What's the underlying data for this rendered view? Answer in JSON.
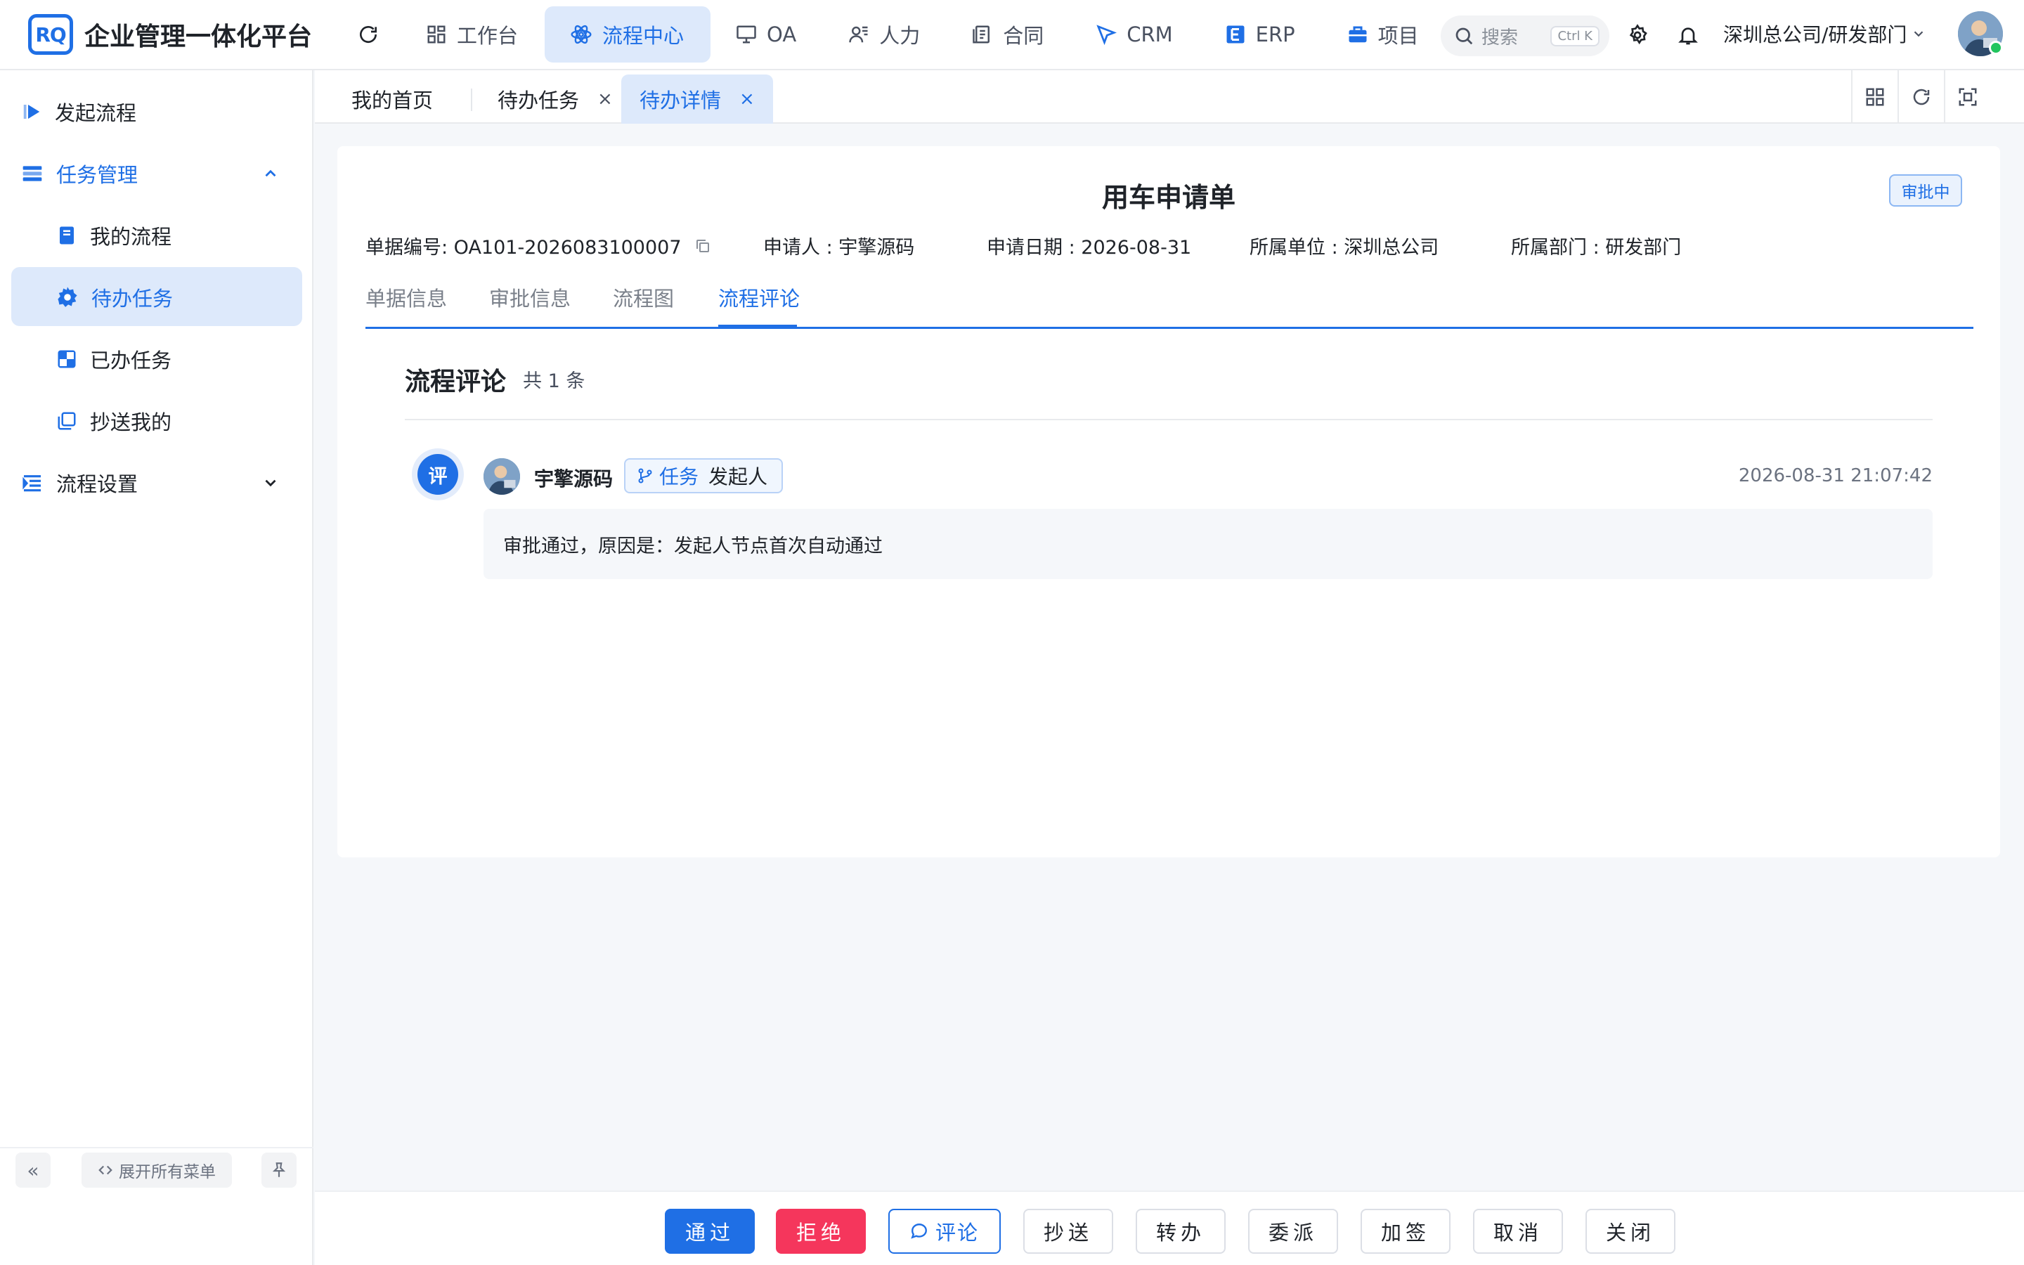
{
  "app": {
    "logo_text": "RQ",
    "title": "企业管理一体化平台"
  },
  "topnav": {
    "items": [
      {
        "label": "工作台",
        "icon": "dashboard-icon"
      },
      {
        "label": "流程中心",
        "icon": "workflow-icon"
      },
      {
        "label": "OA",
        "icon": "monitor-icon"
      },
      {
        "label": "人力",
        "icon": "people-icon"
      },
      {
        "label": "合同",
        "icon": "document-icon"
      },
      {
        "label": "CRM",
        "icon": "send-icon"
      },
      {
        "label": "ERP",
        "icon": "erp-icon"
      },
      {
        "label": "项目",
        "icon": "briefcase-icon"
      }
    ],
    "active_index": 1,
    "more": "···"
  },
  "header": {
    "search_placeholder": "搜索",
    "search_shortcut": "Ctrl K",
    "org": "深圳总公司/研发部门"
  },
  "sidebar": {
    "items": [
      {
        "label": "发起流程",
        "icon": "play-icon"
      },
      {
        "label": "任务管理",
        "icon": "task-list-icon"
      },
      {
        "label": "我的流程",
        "icon": "book-icon"
      },
      {
        "label": "待办任务",
        "icon": "gear-icon"
      },
      {
        "label": "已办任务",
        "icon": "checker-icon"
      },
      {
        "label": "抄送我的",
        "icon": "copy-icon"
      },
      {
        "label": "流程设置",
        "icon": "settings-list-icon"
      }
    ],
    "expand_all": "展开所有菜单",
    "collapse": "«"
  },
  "page_tabs": [
    {
      "label": "我的首页",
      "closable": false
    },
    {
      "label": "待办任务",
      "closable": true
    },
    {
      "label": "待办详情",
      "closable": true
    }
  ],
  "page_tabs_close": "×",
  "form": {
    "title": "用车申请单",
    "status": "审批中",
    "doc_no": "单据编号: OA101-2026083100007",
    "applicant": "申请人 : 宇擎源码",
    "apply_date": "申请日期 : 2026-08-31",
    "unit": "所属单位 : 深圳总公司",
    "dept": "所属部门 : 研发部门"
  },
  "detail_tabs": [
    "单据信息",
    "审批信息",
    "流程图",
    "流程评论"
  ],
  "detail_active": 3,
  "comments": {
    "title": "流程评论",
    "count": "共 1 条",
    "badge": "评",
    "items": [
      {
        "author": "宇擎源码",
        "tag_key": "任务",
        "tag_value": "发起人",
        "time": "2026-08-31 21:07:42",
        "content": "审批通过，原因是：发起人节点首次自动通过"
      }
    ]
  },
  "actions": [
    "通过",
    "拒绝",
    "评论",
    "抄送",
    "转办",
    "委派",
    "加签",
    "取消",
    "关闭"
  ],
  "colors": {
    "primary": "#1f6fe5",
    "danger": "#f5365c",
    "active_bg": "#dde9fb",
    "online": "#22c55e"
  }
}
